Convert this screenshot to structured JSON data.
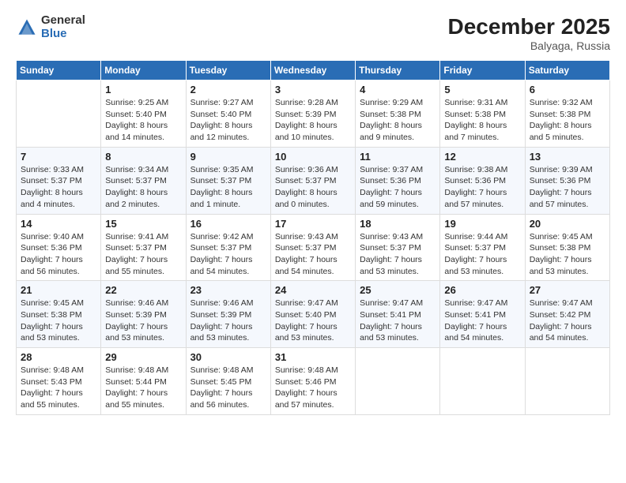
{
  "logo": {
    "general": "General",
    "blue": "Blue"
  },
  "header": {
    "month_year": "December 2025",
    "location": "Balyaga, Russia"
  },
  "days_of_week": [
    "Sunday",
    "Monday",
    "Tuesday",
    "Wednesday",
    "Thursday",
    "Friday",
    "Saturday"
  ],
  "weeks": [
    [
      {
        "day": "",
        "info": ""
      },
      {
        "day": "1",
        "info": "Sunrise: 9:25 AM\nSunset: 5:40 PM\nDaylight: 8 hours\nand 14 minutes."
      },
      {
        "day": "2",
        "info": "Sunrise: 9:27 AM\nSunset: 5:40 PM\nDaylight: 8 hours\nand 12 minutes."
      },
      {
        "day": "3",
        "info": "Sunrise: 9:28 AM\nSunset: 5:39 PM\nDaylight: 8 hours\nand 10 minutes."
      },
      {
        "day": "4",
        "info": "Sunrise: 9:29 AM\nSunset: 5:38 PM\nDaylight: 8 hours\nand 9 minutes."
      },
      {
        "day": "5",
        "info": "Sunrise: 9:31 AM\nSunset: 5:38 PM\nDaylight: 8 hours\nand 7 minutes."
      },
      {
        "day": "6",
        "info": "Sunrise: 9:32 AM\nSunset: 5:38 PM\nDaylight: 8 hours\nand 5 minutes."
      }
    ],
    [
      {
        "day": "7",
        "info": "Sunrise: 9:33 AM\nSunset: 5:37 PM\nDaylight: 8 hours\nand 4 minutes."
      },
      {
        "day": "8",
        "info": "Sunrise: 9:34 AM\nSunset: 5:37 PM\nDaylight: 8 hours\nand 2 minutes."
      },
      {
        "day": "9",
        "info": "Sunrise: 9:35 AM\nSunset: 5:37 PM\nDaylight: 8 hours\nand 1 minute."
      },
      {
        "day": "10",
        "info": "Sunrise: 9:36 AM\nSunset: 5:37 PM\nDaylight: 8 hours\nand 0 minutes."
      },
      {
        "day": "11",
        "info": "Sunrise: 9:37 AM\nSunset: 5:36 PM\nDaylight: 7 hours\nand 59 minutes."
      },
      {
        "day": "12",
        "info": "Sunrise: 9:38 AM\nSunset: 5:36 PM\nDaylight: 7 hours\nand 57 minutes."
      },
      {
        "day": "13",
        "info": "Sunrise: 9:39 AM\nSunset: 5:36 PM\nDaylight: 7 hours\nand 57 minutes."
      }
    ],
    [
      {
        "day": "14",
        "info": "Sunrise: 9:40 AM\nSunset: 5:36 PM\nDaylight: 7 hours\nand 56 minutes."
      },
      {
        "day": "15",
        "info": "Sunrise: 9:41 AM\nSunset: 5:37 PM\nDaylight: 7 hours\nand 55 minutes."
      },
      {
        "day": "16",
        "info": "Sunrise: 9:42 AM\nSunset: 5:37 PM\nDaylight: 7 hours\nand 54 minutes."
      },
      {
        "day": "17",
        "info": "Sunrise: 9:43 AM\nSunset: 5:37 PM\nDaylight: 7 hours\nand 54 minutes."
      },
      {
        "day": "18",
        "info": "Sunrise: 9:43 AM\nSunset: 5:37 PM\nDaylight: 7 hours\nand 53 minutes."
      },
      {
        "day": "19",
        "info": "Sunrise: 9:44 AM\nSunset: 5:37 PM\nDaylight: 7 hours\nand 53 minutes."
      },
      {
        "day": "20",
        "info": "Sunrise: 9:45 AM\nSunset: 5:38 PM\nDaylight: 7 hours\nand 53 minutes."
      }
    ],
    [
      {
        "day": "21",
        "info": "Sunrise: 9:45 AM\nSunset: 5:38 PM\nDaylight: 7 hours\nand 53 minutes."
      },
      {
        "day": "22",
        "info": "Sunrise: 9:46 AM\nSunset: 5:39 PM\nDaylight: 7 hours\nand 53 minutes."
      },
      {
        "day": "23",
        "info": "Sunrise: 9:46 AM\nSunset: 5:39 PM\nDaylight: 7 hours\nand 53 minutes."
      },
      {
        "day": "24",
        "info": "Sunrise: 9:47 AM\nSunset: 5:40 PM\nDaylight: 7 hours\nand 53 minutes."
      },
      {
        "day": "25",
        "info": "Sunrise: 9:47 AM\nSunset: 5:41 PM\nDaylight: 7 hours\nand 53 minutes."
      },
      {
        "day": "26",
        "info": "Sunrise: 9:47 AM\nSunset: 5:41 PM\nDaylight: 7 hours\nand 54 minutes."
      },
      {
        "day": "27",
        "info": "Sunrise: 9:47 AM\nSunset: 5:42 PM\nDaylight: 7 hours\nand 54 minutes."
      }
    ],
    [
      {
        "day": "28",
        "info": "Sunrise: 9:48 AM\nSunset: 5:43 PM\nDaylight: 7 hours\nand 55 minutes."
      },
      {
        "day": "29",
        "info": "Sunrise: 9:48 AM\nSunset: 5:44 PM\nDaylight: 7 hours\nand 55 minutes."
      },
      {
        "day": "30",
        "info": "Sunrise: 9:48 AM\nSunset: 5:45 PM\nDaylight: 7 hours\nand 56 minutes."
      },
      {
        "day": "31",
        "info": "Sunrise: 9:48 AM\nSunset: 5:46 PM\nDaylight: 7 hours\nand 57 minutes."
      },
      {
        "day": "",
        "info": ""
      },
      {
        "day": "",
        "info": ""
      },
      {
        "day": "",
        "info": ""
      }
    ]
  ]
}
